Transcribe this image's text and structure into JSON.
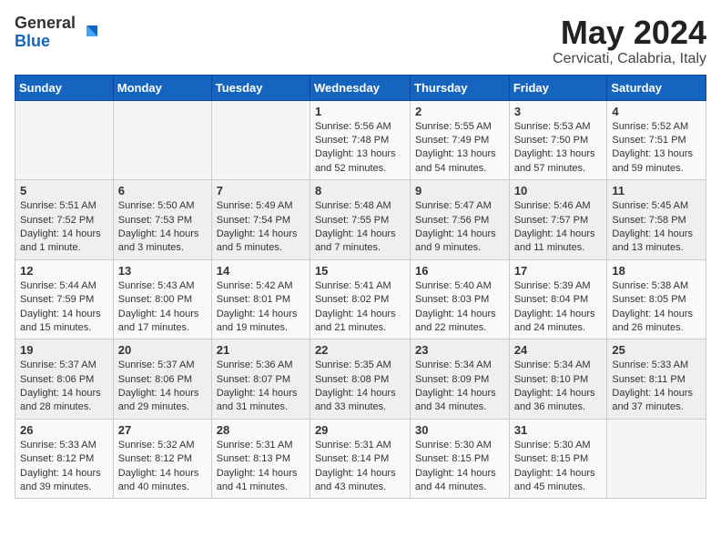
{
  "logo": {
    "general": "General",
    "blue": "Blue"
  },
  "title": "May 2024",
  "location": "Cervicati, Calabria, Italy",
  "headers": [
    "Sunday",
    "Monday",
    "Tuesday",
    "Wednesday",
    "Thursday",
    "Friday",
    "Saturday"
  ],
  "weeks": [
    [
      {
        "day": "",
        "info": ""
      },
      {
        "day": "",
        "info": ""
      },
      {
        "day": "",
        "info": ""
      },
      {
        "day": "1",
        "info": "Sunrise: 5:56 AM\nSunset: 7:48 PM\nDaylight: 13 hours\nand 52 minutes."
      },
      {
        "day": "2",
        "info": "Sunrise: 5:55 AM\nSunset: 7:49 PM\nDaylight: 13 hours\nand 54 minutes."
      },
      {
        "day": "3",
        "info": "Sunrise: 5:53 AM\nSunset: 7:50 PM\nDaylight: 13 hours\nand 57 minutes."
      },
      {
        "day": "4",
        "info": "Sunrise: 5:52 AM\nSunset: 7:51 PM\nDaylight: 13 hours\nand 59 minutes."
      }
    ],
    [
      {
        "day": "5",
        "info": "Sunrise: 5:51 AM\nSunset: 7:52 PM\nDaylight: 14 hours\nand 1 minute."
      },
      {
        "day": "6",
        "info": "Sunrise: 5:50 AM\nSunset: 7:53 PM\nDaylight: 14 hours\nand 3 minutes."
      },
      {
        "day": "7",
        "info": "Sunrise: 5:49 AM\nSunset: 7:54 PM\nDaylight: 14 hours\nand 5 minutes."
      },
      {
        "day": "8",
        "info": "Sunrise: 5:48 AM\nSunset: 7:55 PM\nDaylight: 14 hours\nand 7 minutes."
      },
      {
        "day": "9",
        "info": "Sunrise: 5:47 AM\nSunset: 7:56 PM\nDaylight: 14 hours\nand 9 minutes."
      },
      {
        "day": "10",
        "info": "Sunrise: 5:46 AM\nSunset: 7:57 PM\nDaylight: 14 hours\nand 11 minutes."
      },
      {
        "day": "11",
        "info": "Sunrise: 5:45 AM\nSunset: 7:58 PM\nDaylight: 14 hours\nand 13 minutes."
      }
    ],
    [
      {
        "day": "12",
        "info": "Sunrise: 5:44 AM\nSunset: 7:59 PM\nDaylight: 14 hours\nand 15 minutes."
      },
      {
        "day": "13",
        "info": "Sunrise: 5:43 AM\nSunset: 8:00 PM\nDaylight: 14 hours\nand 17 minutes."
      },
      {
        "day": "14",
        "info": "Sunrise: 5:42 AM\nSunset: 8:01 PM\nDaylight: 14 hours\nand 19 minutes."
      },
      {
        "day": "15",
        "info": "Sunrise: 5:41 AM\nSunset: 8:02 PM\nDaylight: 14 hours\nand 21 minutes."
      },
      {
        "day": "16",
        "info": "Sunrise: 5:40 AM\nSunset: 8:03 PM\nDaylight: 14 hours\nand 22 minutes."
      },
      {
        "day": "17",
        "info": "Sunrise: 5:39 AM\nSunset: 8:04 PM\nDaylight: 14 hours\nand 24 minutes."
      },
      {
        "day": "18",
        "info": "Sunrise: 5:38 AM\nSunset: 8:05 PM\nDaylight: 14 hours\nand 26 minutes."
      }
    ],
    [
      {
        "day": "19",
        "info": "Sunrise: 5:37 AM\nSunset: 8:06 PM\nDaylight: 14 hours\nand 28 minutes."
      },
      {
        "day": "20",
        "info": "Sunrise: 5:37 AM\nSunset: 8:06 PM\nDaylight: 14 hours\nand 29 minutes."
      },
      {
        "day": "21",
        "info": "Sunrise: 5:36 AM\nSunset: 8:07 PM\nDaylight: 14 hours\nand 31 minutes."
      },
      {
        "day": "22",
        "info": "Sunrise: 5:35 AM\nSunset: 8:08 PM\nDaylight: 14 hours\nand 33 minutes."
      },
      {
        "day": "23",
        "info": "Sunrise: 5:34 AM\nSunset: 8:09 PM\nDaylight: 14 hours\nand 34 minutes."
      },
      {
        "day": "24",
        "info": "Sunrise: 5:34 AM\nSunset: 8:10 PM\nDaylight: 14 hours\nand 36 minutes."
      },
      {
        "day": "25",
        "info": "Sunrise: 5:33 AM\nSunset: 8:11 PM\nDaylight: 14 hours\nand 37 minutes."
      }
    ],
    [
      {
        "day": "26",
        "info": "Sunrise: 5:33 AM\nSunset: 8:12 PM\nDaylight: 14 hours\nand 39 minutes."
      },
      {
        "day": "27",
        "info": "Sunrise: 5:32 AM\nSunset: 8:12 PM\nDaylight: 14 hours\nand 40 minutes."
      },
      {
        "day": "28",
        "info": "Sunrise: 5:31 AM\nSunset: 8:13 PM\nDaylight: 14 hours\nand 41 minutes."
      },
      {
        "day": "29",
        "info": "Sunrise: 5:31 AM\nSunset: 8:14 PM\nDaylight: 14 hours\nand 43 minutes."
      },
      {
        "day": "30",
        "info": "Sunrise: 5:30 AM\nSunset: 8:15 PM\nDaylight: 14 hours\nand 44 minutes."
      },
      {
        "day": "31",
        "info": "Sunrise: 5:30 AM\nSunset: 8:15 PM\nDaylight: 14 hours\nand 45 minutes."
      },
      {
        "day": "",
        "info": ""
      }
    ]
  ]
}
